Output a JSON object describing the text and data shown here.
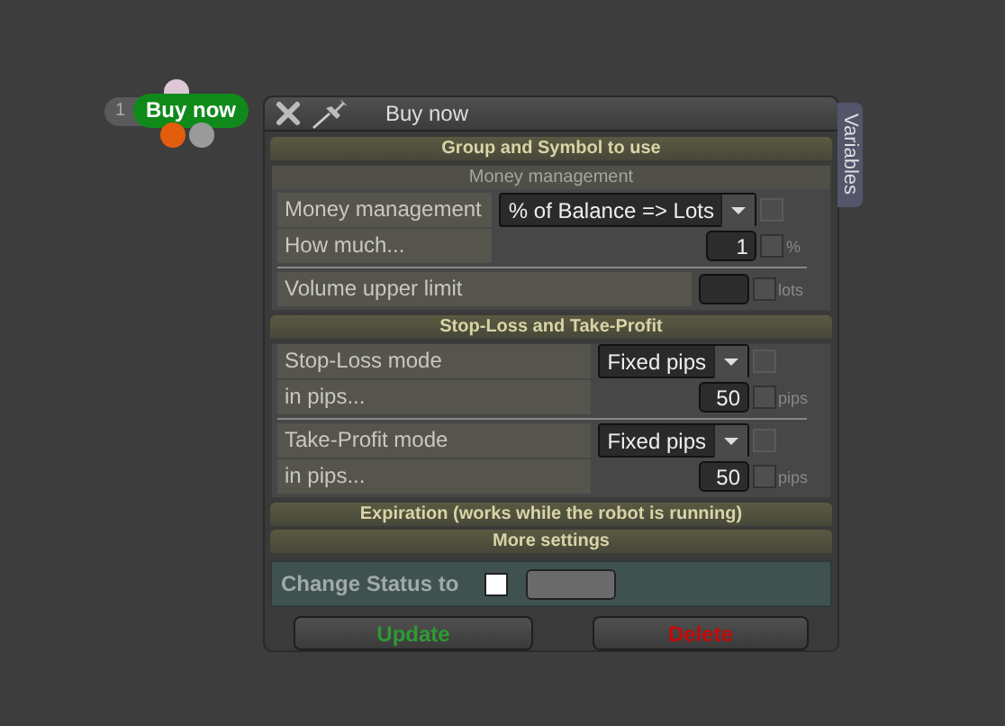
{
  "node": {
    "index": "1",
    "label": "Buy now"
  },
  "window": {
    "title": "Buy now",
    "side_tab": "Variables"
  },
  "sections": [
    {
      "kind": "header",
      "title": "Group and Symbol to use"
    },
    {
      "kind": "group",
      "subtitle": "Money management",
      "blocks": [
        [
          {
            "kind": "select",
            "label": "Money management",
            "value": "% of Balance => Lots",
            "checked": false
          },
          {
            "kind": "number",
            "label": "How much...",
            "value": "1",
            "unit": "%",
            "checked": false
          }
        ],
        [
          {
            "kind": "number",
            "label": "Volume upper limit",
            "unit": "lots",
            "checked": false
          }
        ]
      ]
    },
    {
      "kind": "header",
      "title": "Stop-Loss and Take-Profit"
    },
    {
      "kind": "group",
      "blocks": [
        [
          {
            "kind": "select",
            "label": "Stop-Loss mode",
            "value": "Fixed pips",
            "checked": false
          },
          {
            "kind": "number",
            "label": "in pips...",
            "value": "50",
            "unit": "pips",
            "checked": false
          }
        ],
        [
          {
            "kind": "select",
            "label": "Take-Profit mode",
            "value": "Fixed pips",
            "checked": false
          },
          {
            "kind": "number",
            "label": "in pips...",
            "value": "50",
            "unit": "pips",
            "checked": false
          }
        ]
      ]
    },
    {
      "kind": "header",
      "title": "Expiration (works while the robot is running)"
    },
    {
      "kind": "header",
      "title": "More settings"
    },
    {
      "kind": "status",
      "label": "Change Status to",
      "checked": false
    }
  ],
  "buttons": [
    {
      "kind": "update",
      "label": "Update"
    },
    {
      "kind": "delete",
      "label": "Delete"
    }
  ]
}
